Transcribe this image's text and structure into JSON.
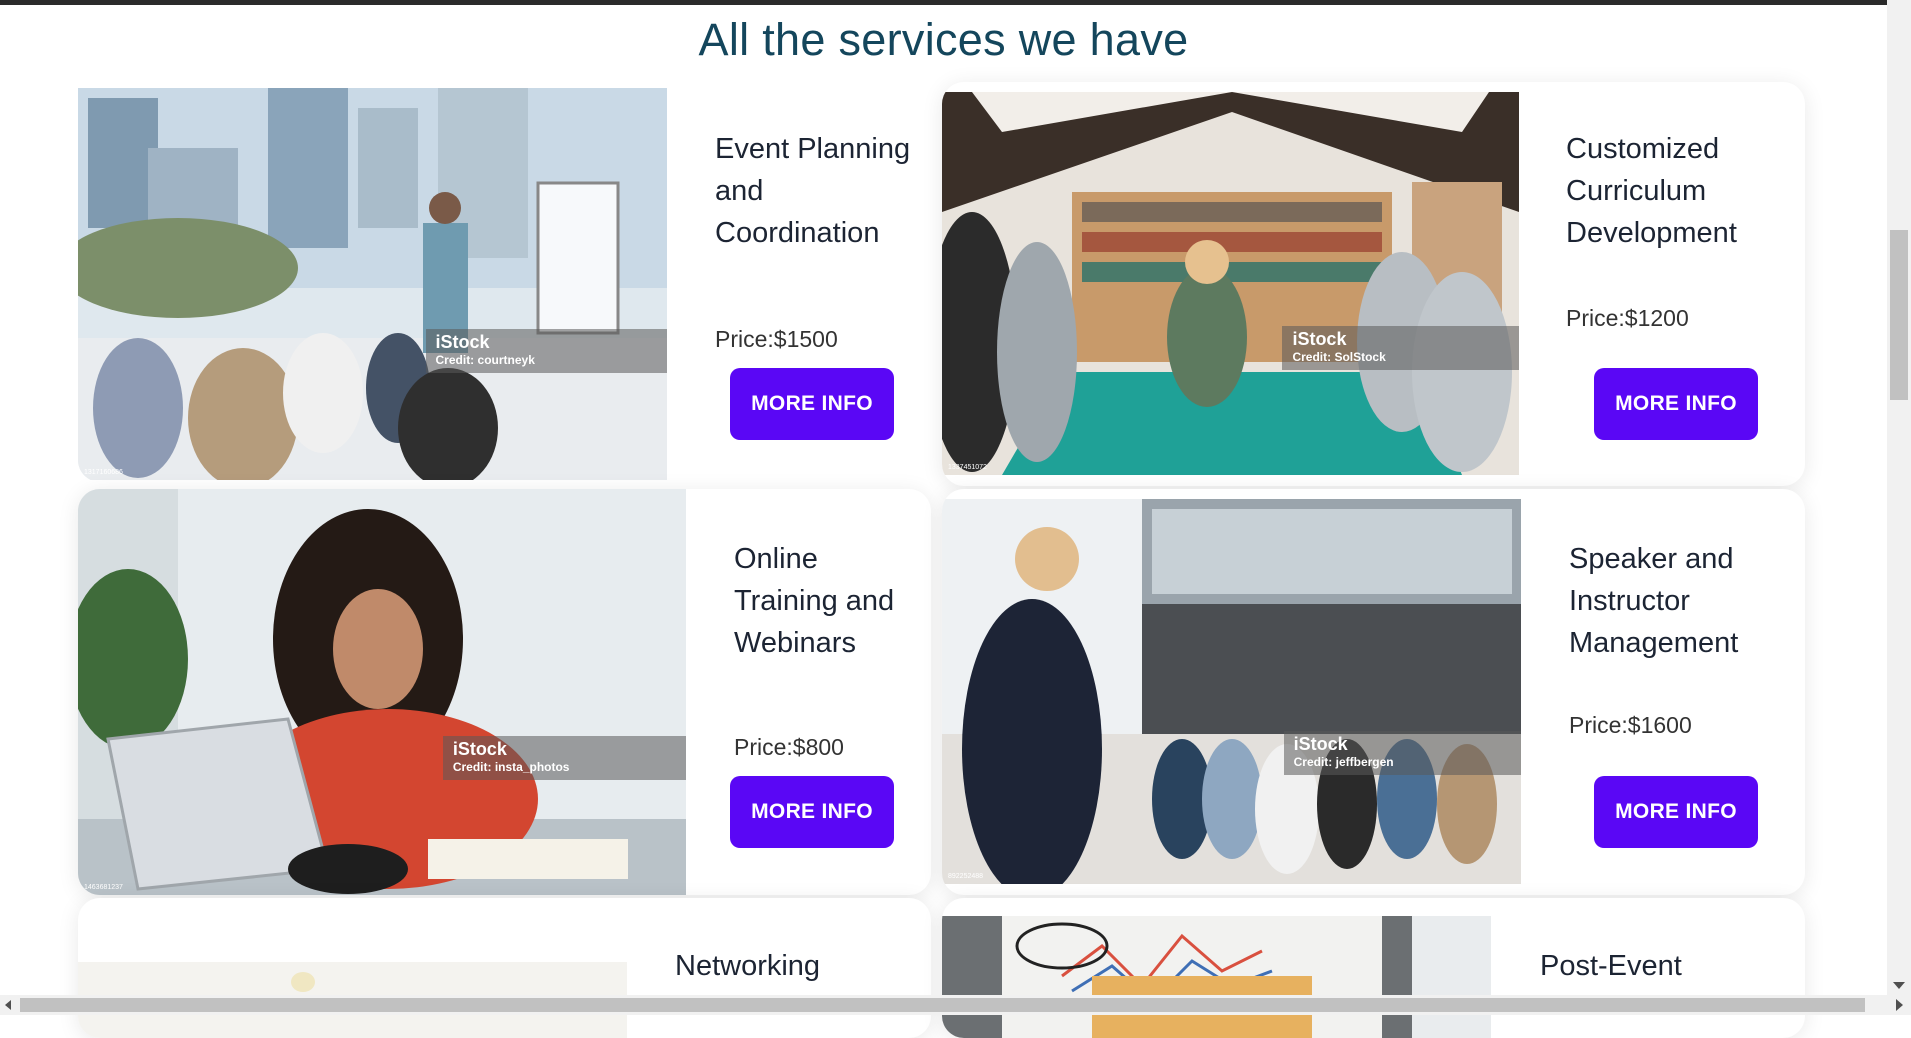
{
  "page": {
    "heading": "All the services we have"
  },
  "colors": {
    "button": "#5a07f5",
    "heading": "#14465c"
  },
  "services": [
    {
      "title": "Event Planning and Coordination",
      "price": "Price:$1500",
      "button": "MORE INFO",
      "stock_brand": "iStock",
      "credit": "Credit: courtneyk",
      "image_id": "1317160686"
    },
    {
      "title": "Customized Curriculum Development",
      "price": "Price:$1200",
      "button": "MORE INFO",
      "stock_brand": "iStock",
      "credit": "Credit: SolStock",
      "image_id": "1337451072"
    },
    {
      "title": "Online Training and Webinars",
      "price": "Price:$800",
      "button": "MORE INFO",
      "stock_brand": "iStock",
      "credit": "Credit: insta_photos",
      "image_id": "1463681237"
    },
    {
      "title": "Speaker and Instructor Management",
      "price": "Price:$1600",
      "button": "MORE INFO",
      "stock_brand": "iStock",
      "credit": "Credit: jeffbergen",
      "image_id": "892252488"
    },
    {
      "title": "Networking"
    },
    {
      "title": "Post-Event"
    }
  ]
}
